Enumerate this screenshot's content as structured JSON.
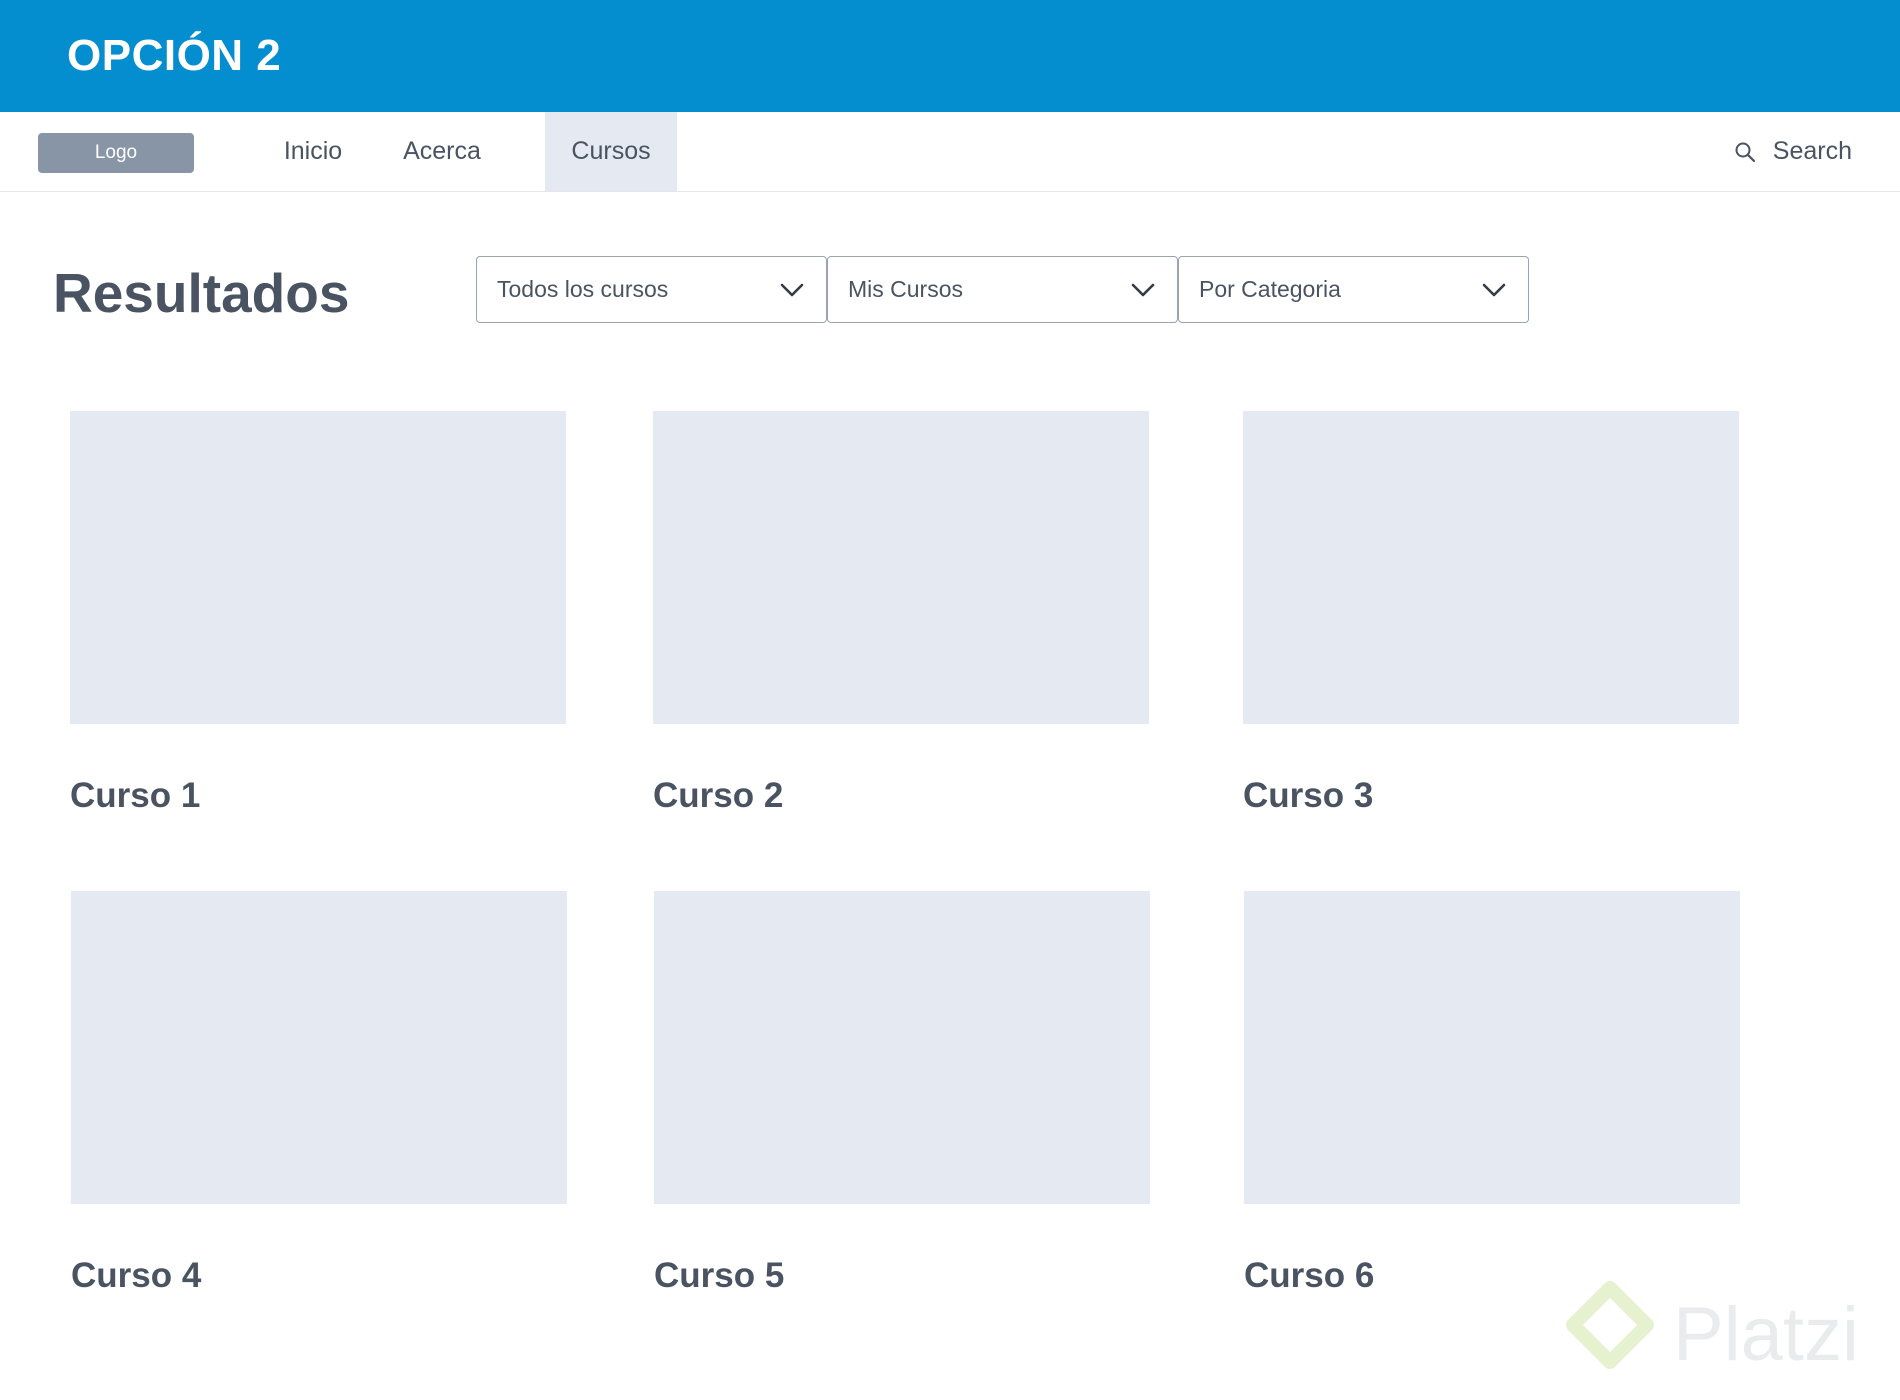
{
  "banner": {
    "title": "OPCIÓN 2"
  },
  "nav": {
    "logo": "Logo",
    "items": [
      {
        "label": "Inicio"
      },
      {
        "label": "Acerca"
      },
      {
        "label": "Cursos",
        "active": true
      }
    ],
    "search_label": "Search",
    "search_icon": "search-icon"
  },
  "main": {
    "title": "Resultados",
    "filters": [
      {
        "label": "Todos los cursos",
        "icon": "chevron-down-icon"
      },
      {
        "label": "Mis Cursos",
        "icon": "chevron-down-icon"
      },
      {
        "label": "Por Categoria",
        "icon": "chevron-down-icon"
      }
    ],
    "courses": [
      {
        "title": "Curso 1"
      },
      {
        "title": "Curso 2"
      },
      {
        "title": "Curso 3"
      },
      {
        "title": "Curso 4"
      },
      {
        "title": "Curso 5"
      },
      {
        "title": "Curso 6"
      }
    ]
  },
  "watermark": {
    "text": "Platzi"
  },
  "colors": {
    "banner": "#058ecf",
    "text": "#4a5361",
    "placeholder": "#e5e9f2",
    "logo": "#8895a7",
    "watermark": "#98c93c"
  }
}
